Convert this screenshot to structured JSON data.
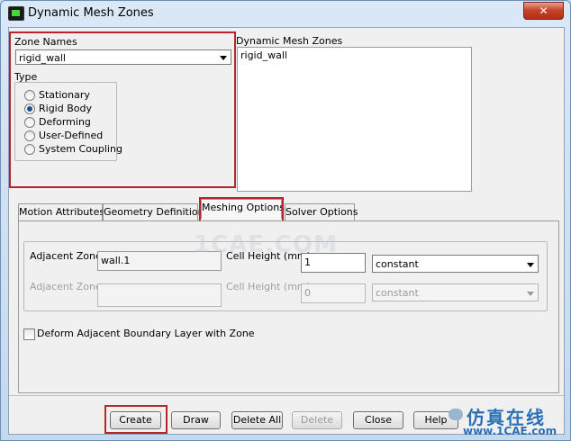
{
  "window": {
    "title": "Dynamic Mesh Zones",
    "close_glyph": "✕"
  },
  "zone_names": {
    "label": "Zone Names",
    "selected": "rigid_wall"
  },
  "type": {
    "label": "Type",
    "options": [
      "Stationary",
      "Rigid Body",
      "Deforming",
      "User-Defined",
      "System Coupling"
    ],
    "selected": "Rigid Body"
  },
  "dynamic_mesh_zones": {
    "label": "Dynamic Mesh Zones",
    "items": [
      "rigid_wall"
    ]
  },
  "tabs": [
    "Motion Attributes",
    "Geometry Definition",
    "Meshing Options",
    "Solver Options"
  ],
  "active_tab": "Meshing Options",
  "meshing": {
    "row1": {
      "adjacent_label": "Adjacent Zone",
      "adjacent_value": "wall.1",
      "cell_height_label": "Cell Height (mm)",
      "cell_height_value": "1",
      "method": "constant"
    },
    "row2": {
      "adjacent_label": "Adjacent Zone",
      "adjacent_value": "",
      "cell_height_label": "Cell Height (mm)",
      "cell_height_value": "0",
      "method": "constant"
    },
    "deform_checkbox_label": "Deform Adjacent Boundary Layer with Zone",
    "deform_checked": false
  },
  "buttons": {
    "create": "Create",
    "draw": "Draw",
    "delete_all": "Delete All",
    "delete": "Delete",
    "close": "Close",
    "help": "Help"
  },
  "watermark": "1CAE.COM",
  "brand": {
    "chinese": "仿真在线",
    "url": "www.1CAE.com"
  },
  "colors": {
    "highlight": "#b3262b",
    "title_bg": "#c4d8ee",
    "selected_radio": "#1f4f8f"
  }
}
